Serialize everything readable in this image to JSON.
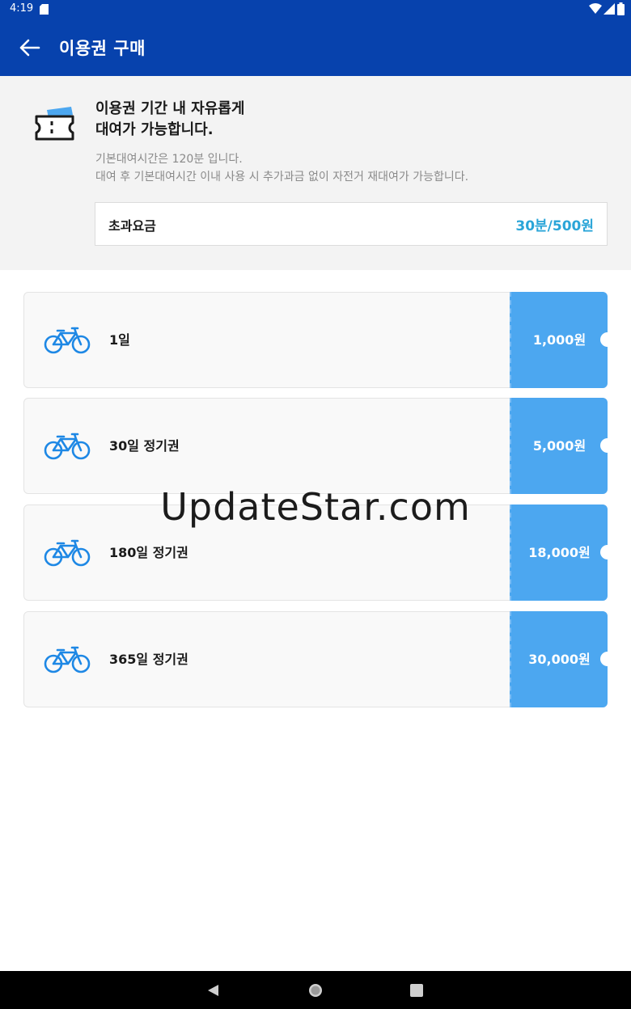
{
  "status_bar": {
    "time": "4:19",
    "icons": [
      "sd-card-icon",
      "wifi-icon",
      "signal-icon",
      "battery-icon"
    ]
  },
  "app_bar": {
    "title": "이용권 구매",
    "back_icon": "arrow-left-icon",
    "background_color": "#0742ad"
  },
  "info": {
    "icon": "ticket-icon",
    "headline_line1": "이용권 기간 내 자유롭게",
    "headline_line2": "대여가 가능합니다.",
    "desc_line1": "기본대여시간은 120분 입니다.",
    "desc_line2": "대여 후 기본대여시간 이내 사용 시 추가과금 없이 자전거 재대여가 가능합니다.",
    "overtime_label": "초과요금",
    "overtime_value": "30분/500원",
    "accent_color": "#2aa5d8"
  },
  "passes": [
    {
      "name": "1일",
      "price": "1,000원",
      "icon": "bicycle-icon"
    },
    {
      "name": "30일 정기권",
      "price": "5,000원",
      "icon": "bicycle-icon"
    },
    {
      "name": "180일 정기권",
      "price": "18,000원",
      "icon": "bicycle-icon"
    },
    {
      "name": "365일 정기권",
      "price": "30,000원",
      "icon": "bicycle-icon"
    }
  ],
  "price_tab_color": "#4ca7f0",
  "watermark": "UpdateStar.com",
  "nav_bar": {
    "icons": [
      "nav-back-icon",
      "nav-home-icon",
      "nav-recents-icon"
    ]
  }
}
